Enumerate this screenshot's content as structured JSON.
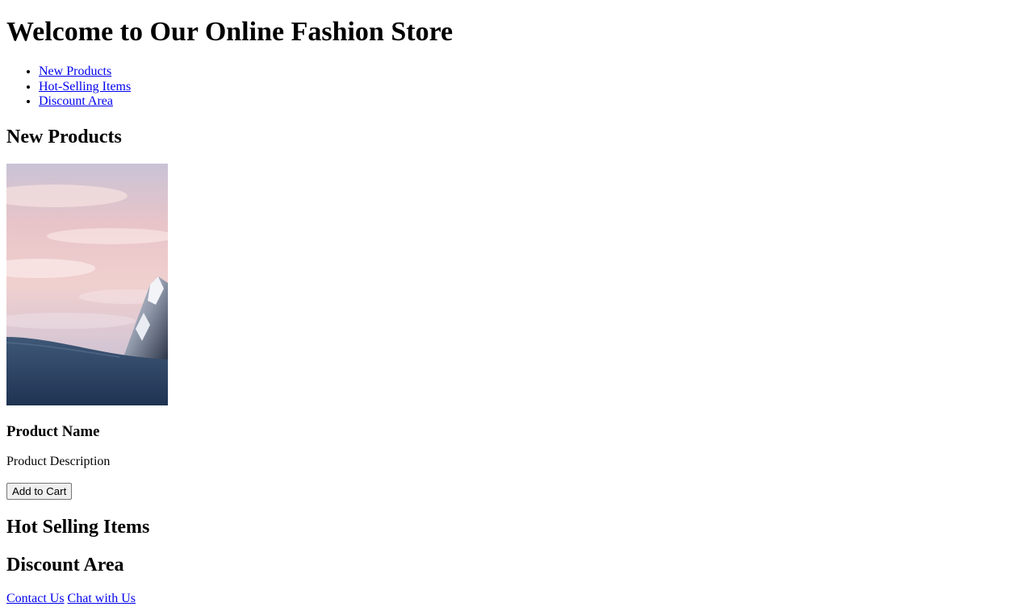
{
  "header": {
    "title": "Welcome to Our Online Fashion Store"
  },
  "nav": {
    "items": [
      {
        "label": "New Products"
      },
      {
        "label": "Hot-Selling Items"
      },
      {
        "label": "Discount Area"
      }
    ]
  },
  "sections": {
    "new_products": {
      "heading": "New Products",
      "product": {
        "image_icon": "mountain-landscape-image",
        "name": "Product Name",
        "description": "Product Description",
        "button_label": "Add to Cart"
      }
    },
    "hot_selling": {
      "heading": "Hot Selling Items"
    },
    "discount": {
      "heading": "Discount Area"
    }
  },
  "footer": {
    "links": [
      {
        "label": "Contact Us"
      },
      {
        "label": "Chat with Us"
      }
    ]
  },
  "colors": {
    "link": "#0000ee",
    "text": "#000000",
    "background": "#ffffff"
  }
}
